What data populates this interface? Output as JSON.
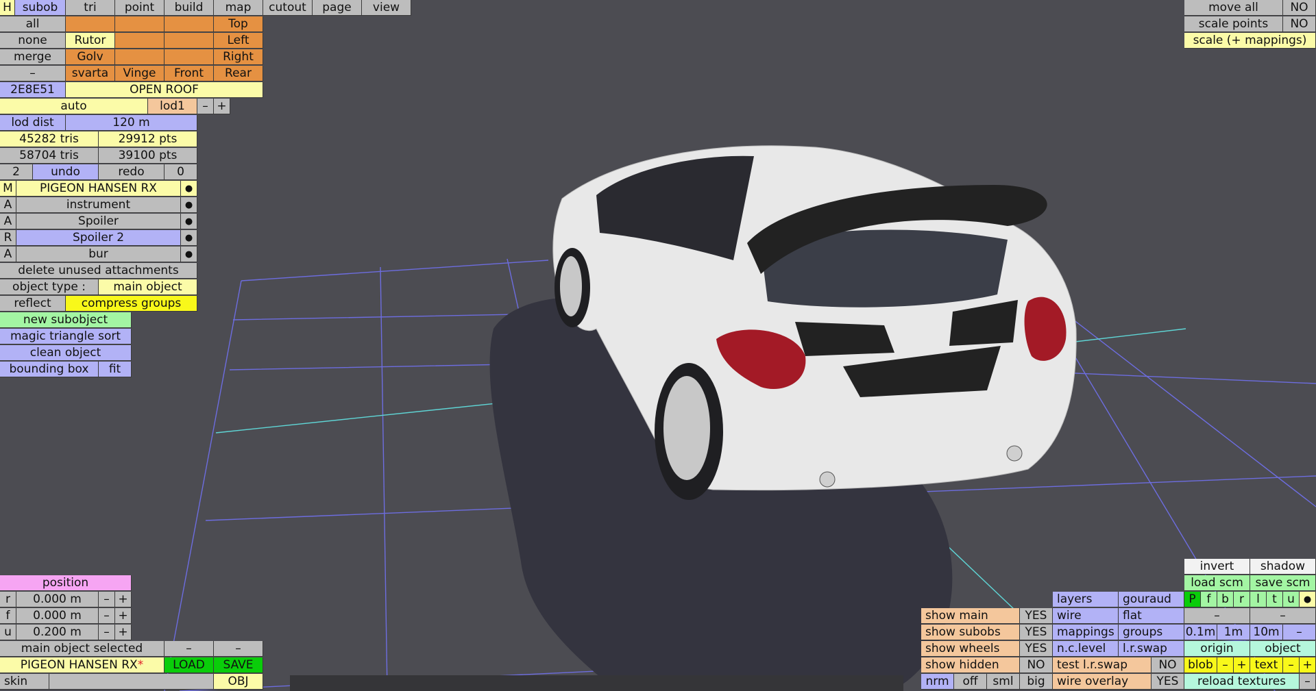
{
  "menu": {
    "h": "H",
    "items": [
      "subob",
      "tri",
      "point",
      "build",
      "map",
      "cutout",
      "page",
      "view"
    ]
  },
  "select": {
    "all": "all",
    "none": "none",
    "merge": "merge",
    "minus": "–",
    "g1": "Rutor",
    "g2": "Golv",
    "svarta": "svarta",
    "vinge": "Vinge",
    "front": "Front",
    "rear": "Rear",
    "top": "Top",
    "left": "Left",
    "right": "Right",
    "color_code": "2E8E51",
    "group_name": "OPEN ROOF"
  },
  "lod": {
    "auto": "auto",
    "level": "lod1",
    "minus": "–",
    "plus": "+",
    "dist_label": "lod dist",
    "dist_value": "120 m"
  },
  "stats": {
    "tris1": "45282 tris",
    "pts1": "29912 pts",
    "tris2": "58704 tris",
    "pts2": "39100 pts"
  },
  "undo": {
    "count": "2",
    "undo": "undo",
    "redo": "redo",
    "redo_count": "0"
  },
  "attachments": [
    {
      "prefix": "M",
      "name": "PIGEON HANSEN RX",
      "dot": "●"
    },
    {
      "prefix": "A",
      "name": "instrument",
      "dot": "●"
    },
    {
      "prefix": "A",
      "name": "Spoiler",
      "dot": "●"
    },
    {
      "prefix": "R",
      "name": "Spoiler 2",
      "dot": "●"
    },
    {
      "prefix": "A",
      "name": "bur",
      "dot": "●"
    }
  ],
  "object": {
    "delete_unused": "delete unused attachments",
    "type_label": "object type :",
    "type_value": "main object",
    "reflect": "reflect",
    "compress": "compress groups",
    "new_sub": "new subobject",
    "magic": "magic triangle sort",
    "clean": "clean object",
    "bbox": "bounding box",
    "fit": "fit"
  },
  "topright": {
    "move_all": "move all",
    "move_all_val": "NO",
    "scale_points": "scale points",
    "scale_points_val": "NO",
    "scale_mappings": "scale (+ mappings)"
  },
  "position": {
    "title": "position",
    "rows": [
      {
        "axis": "r",
        "value": "0.000 m",
        "minus": "–",
        "plus": "+"
      },
      {
        "axis": "f",
        "value": "0.000 m",
        "minus": "–",
        "plus": "+"
      },
      {
        "axis": "u",
        "value": "0.200 m",
        "minus": "–",
        "plus": "+"
      }
    ],
    "selected": "main object selected",
    "sel_minus1": "–",
    "sel_minus2": "–"
  },
  "file": {
    "name": "PIGEON HANSEN RX",
    "modified": "*",
    "load": "LOAD",
    "save": "SAVE",
    "skin": "skin",
    "obj": "OBJ"
  },
  "display": {
    "show_main": "show main",
    "show_main_val": "YES",
    "show_subobs": "show subobs",
    "show_subobs_val": "YES",
    "show_wheels": "show wheels",
    "show_wheels_val": "YES",
    "show_hidden": "show hidden",
    "show_hidden_val": "NO",
    "nrm": "nrm",
    "off": "off",
    "sml": "sml",
    "big": "big",
    "layers": "layers",
    "gouraud": "gouraud",
    "wire": "wire",
    "flat": "flat",
    "mappings": "mappings",
    "groups": "groups",
    "nclevel": "n.c.level",
    "lrswap": "l.r.swap",
    "test_lrswap": "test l.r.swap",
    "test_lrswap_val": "NO",
    "wire_overlay": "wire overlay",
    "wire_overlay_val": "YES"
  },
  "right_panel": {
    "invert": "invert",
    "shadow": "shadow",
    "load_scm": "load scm",
    "save_scm": "save scm",
    "layers": [
      "P",
      "f",
      "b",
      "r",
      "l",
      "t",
      "u"
    ],
    "layer_dot": "●",
    "dash1": "–",
    "dash2": "–",
    "step1": "0.1m",
    "step2": "1m",
    "step3": "10m",
    "step_minus": "–",
    "origin": "origin",
    "object": "object",
    "blob": "blob",
    "blob_minus": "–",
    "blob_plus": "+",
    "text": "text",
    "text_minus": "–",
    "text_plus": "+",
    "reload": "reload textures",
    "reload_minus": "–"
  },
  "colors": {
    "background": "#4c4c52",
    "grid": "#6d6de0",
    "grid_axis": "#5fd6d6",
    "car_body": "#e8e8e8",
    "spoiler": "#222222",
    "taillight": "#a31a26",
    "shadow": "#34343f"
  }
}
